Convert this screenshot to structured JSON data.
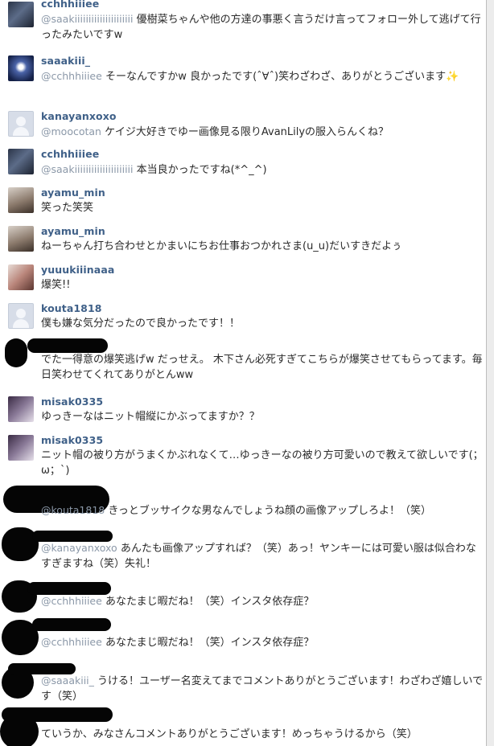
{
  "comments": [
    {
      "username": "cchhhiiiee",
      "mention": "@saakiiiiiiiiiiiiiiiiiiiii",
      "text": "優樹菜ちゃんや他の方達の事悪く言うだけ言ってフォロー外して逃げて行ったみたいですw"
    },
    {
      "username": "saaakiii_",
      "mention": "@cchhhiiiee",
      "text": "そーなんですかw 良かったです(ˆ∀ˆ)笑わざわざ、ありがとうございます✨"
    },
    {
      "username": "kanayanxoxo",
      "mention": "@moocotan",
      "text": "ケイジ大好きでゆー画像見る限りAvanLilyの服入らんくね？"
    },
    {
      "username": "cchhhiiiee",
      "mention": "@saakiiiiiiiiiiiiiiiiiiiii",
      "text": "本当良かったですね(*^_^)"
    },
    {
      "username": "ayamu_min",
      "mention": "",
      "text": "笑った笑笑"
    },
    {
      "username": "ayamu_min",
      "mention": "",
      "text": "ねーちゃん打ち合わせとかまいにちお仕事おつかれさま(u_u)だいすきだよぅ"
    },
    {
      "username": "yuuukiiinaaa",
      "mention": "",
      "text": "爆笑!!"
    },
    {
      "username": "kouta1818",
      "mention": "",
      "text": "僕も嫌な気分だったので良かったです！！"
    },
    {
      "username": "",
      "mention": "",
      "text": "でた一得意の爆笑逃げw だっせえ。 木下さん必死すぎてこちらが爆笑させてもらってます。毎日笑わせてくれてありがとんww"
    },
    {
      "username": "misak0335",
      "mention": "",
      "text": "ゆっきーなはニット帽縦にかぶってますか？？"
    },
    {
      "username": "misak0335",
      "mention": "",
      "text": "ニット帽の被り方がうまくかぶれなくて…ゆっきーなの被り方可愛いので教えて欲しいです(；ω；`)"
    },
    {
      "username": "",
      "mention": "@kouta1818",
      "text": "きっとブッサイクな男なんでしょうね顔の画像アップしろよ！（笑）"
    },
    {
      "username": "",
      "mention": "@kanayanxoxo",
      "text": "あんたも画像アップすれば？（笑）あっ！ヤンキーには可愛い服は似合わなすぎますね（笑）失礼！"
    },
    {
      "username": "",
      "mention": "@cchhhiiiee",
      "text": "あなたまじ暇だね！（笑）インスタ依存症？"
    },
    {
      "username": "",
      "mention": "@cchhhiiiee",
      "text": "あなたまじ暇だね！（笑）インスタ依存症？"
    },
    {
      "username": "",
      "mention": "@saaakiii_",
      "text": "うける！ユーザー名変えてまでコメントありがとうございます！わざわざ嬉しいです（笑）"
    },
    {
      "username": "",
      "mention": "",
      "text": "ていうか、みなさんコメントありがとうございます！めっちゃうけるから（笑）"
    }
  ]
}
